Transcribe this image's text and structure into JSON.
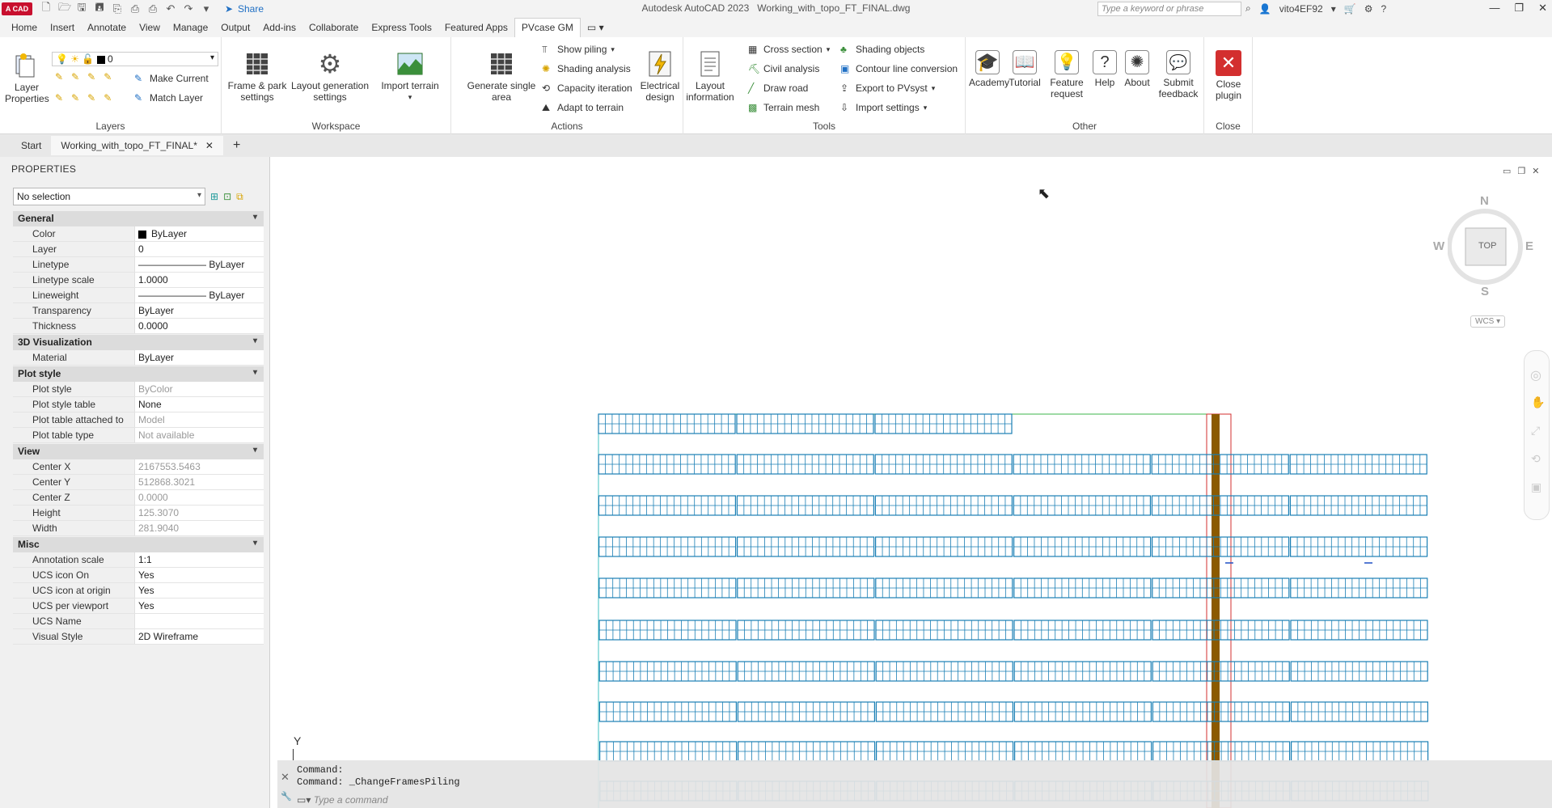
{
  "app": {
    "title": "Autodesk AutoCAD 2023",
    "file": "Working_with_topo_FT_FINAL.dwg",
    "logo_text": "A CAD",
    "share_label": "Share",
    "search_placeholder": "Type a keyword or phrase",
    "user": "vito4EF92"
  },
  "ribbon_tabs": [
    "Home",
    "Insert",
    "Annotate",
    "View",
    "Manage",
    "Output",
    "Add-ins",
    "Collaborate",
    "Express Tools",
    "Featured Apps",
    "PVcase GM"
  ],
  "active_tab": "PVcase GM",
  "ribbon": {
    "layers": {
      "label": "Layers",
      "layer_properties": "Layer Properties",
      "current_layer": "0",
      "make_current": "Make Current",
      "match_layer": "Match Layer"
    },
    "workspace": {
      "label": "Workspace",
      "frame_park": "Frame & park settings",
      "layout_gen": "Layout generation settings",
      "import_terrain": "Import terrain"
    },
    "actions": {
      "label": "Actions",
      "generate_single": "Generate single area",
      "show_piling": "Show piling",
      "shading_analysis": "Shading analysis",
      "capacity_iteration": "Capacity iteration",
      "adapt_terrain": "Adapt to terrain",
      "electrical_design": "Electrical design"
    },
    "tools": {
      "label": "Tools",
      "layout_information": "Layout information",
      "cross_section": "Cross section",
      "civil_analysis": "Civil analysis",
      "draw_road": "Draw road",
      "terrain_mesh": "Terrain mesh",
      "shading_objects": "Shading objects",
      "contour_line": "Contour line conversion",
      "export_pvsyst": "Export to PVsyst",
      "import_settings": "Import settings"
    },
    "other": {
      "label": "Other",
      "academy": "Academy",
      "tutorial": "Tutorial",
      "feature_request": "Feature request",
      "help": "Help",
      "about": "About",
      "submit_feedback": "Submit feedback"
    },
    "close": {
      "label": "Close",
      "close_plugin": "Close plugin"
    }
  },
  "doc_tabs": {
    "start": "Start",
    "active": "Working_with_topo_FT_FINAL*",
    "add": "+"
  },
  "properties": {
    "title": "PROPERTIES",
    "selection": "No selection",
    "sections": [
      {
        "name": "General",
        "rows": [
          {
            "k": "Color",
            "v": "ByLayer"
          },
          {
            "k": "Layer",
            "v": "0"
          },
          {
            "k": "Linetype",
            "v": "——————— ByLayer"
          },
          {
            "k": "Linetype scale",
            "v": "1.0000"
          },
          {
            "k": "Lineweight",
            "v": "——————— ByLayer"
          },
          {
            "k": "Transparency",
            "v": "ByLayer"
          },
          {
            "k": "Thickness",
            "v": "0.0000"
          }
        ]
      },
      {
        "name": "3D Visualization",
        "rows": [
          {
            "k": "Material",
            "v": "ByLayer"
          }
        ]
      },
      {
        "name": "Plot style",
        "rows": [
          {
            "k": "Plot style",
            "v": "ByColor",
            "dim": true
          },
          {
            "k": "Plot style table",
            "v": "None"
          },
          {
            "k": "Plot table attached to",
            "v": "Model",
            "dim": true
          },
          {
            "k": "Plot table type",
            "v": "Not available",
            "dim": true
          }
        ]
      },
      {
        "name": "View",
        "rows": [
          {
            "k": "Center X",
            "v": "2167553.5463",
            "dim": true
          },
          {
            "k": "Center Y",
            "v": "512868.3021",
            "dim": true
          },
          {
            "k": "Center Z",
            "v": "0.0000",
            "dim": true
          },
          {
            "k": "Height",
            "v": "125.3070",
            "dim": true
          },
          {
            "k": "Width",
            "v": "281.9040",
            "dim": true
          }
        ]
      },
      {
        "name": "Misc",
        "rows": [
          {
            "k": "Annotation scale",
            "v": "1:1"
          },
          {
            "k": "UCS icon On",
            "v": "Yes"
          },
          {
            "k": "UCS icon at origin",
            "v": "Yes"
          },
          {
            "k": "UCS per viewport",
            "v": "Yes"
          },
          {
            "k": "UCS Name",
            "v": ""
          },
          {
            "k": "Visual Style",
            "v": "2D Wireframe"
          }
        ]
      }
    ]
  },
  "viewcube": {
    "n": "N",
    "s": "S",
    "e": "E",
    "w": "W",
    "face": "TOP",
    "wcs": "WCS"
  },
  "command": {
    "line1": "Command:",
    "line2": "Command: _ChangeFramesPiling",
    "placeholder": "Type a command"
  },
  "ucs_label": "Y",
  "colors": {
    "frame": "#1a7fb5",
    "green_line": "#3cb44b",
    "road_brown": "#8b5a00",
    "red": "#d32f2f"
  }
}
